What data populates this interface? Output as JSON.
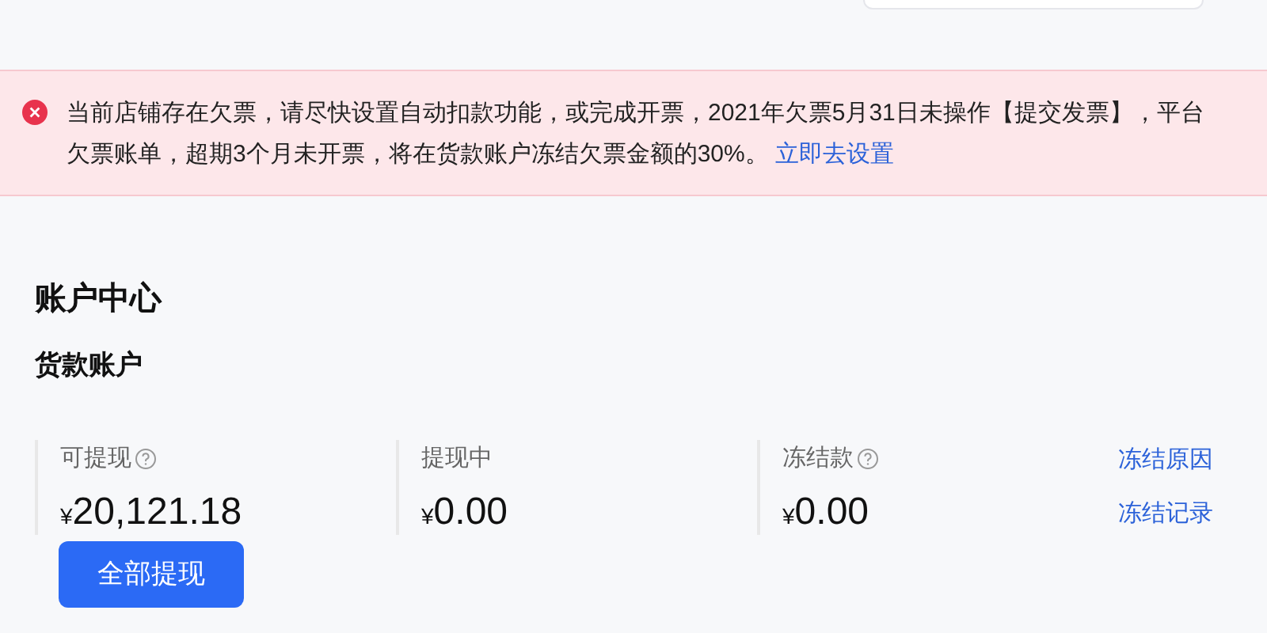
{
  "alert": {
    "lines": [
      "当前店铺存在欠票，请尽快设置自动扣款功能，或完成开票，2021年欠票5月31日未操作【提交发票】，平台",
      "欠票账单，超期3个月未开票，将在货款账户冻结欠票金额的30%。"
    ],
    "link": "立即去设置"
  },
  "page_title": "账户中心",
  "section_title": "货款账户",
  "stats": [
    {
      "label": "可提现",
      "help": true,
      "value": "20,121.18",
      "currency": "¥"
    },
    {
      "label": "提现中",
      "help": false,
      "value": "0.00",
      "currency": "¥"
    },
    {
      "label": "冻结款",
      "help": true,
      "value": "0.00",
      "currency": "¥"
    }
  ],
  "links": [
    "冻结原因",
    "冻结记录"
  ],
  "button": "全部提现"
}
